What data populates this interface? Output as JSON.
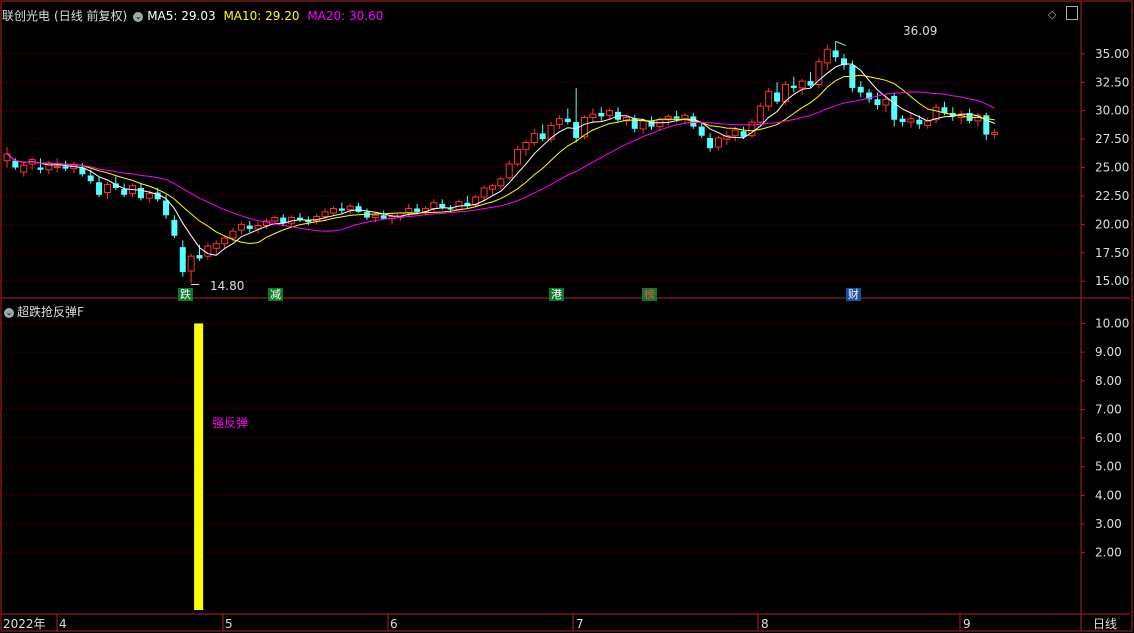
{
  "header": {
    "stock_name": "联创光电",
    "period_mode": "(日线 前复权)",
    "ma5": "MA5: 29.03",
    "ma10": "MA10: 29.20",
    "ma20": "MA20: 30.60"
  },
  "indicator": {
    "name": "超跌抢反弹F",
    "signal_label": "强反弹"
  },
  "event_tags": [
    "跌",
    "减",
    "港",
    "榜",
    "财"
  ],
  "price_annotations": {
    "high": "36.09",
    "low": "14.80"
  },
  "time_axis": {
    "labels": [
      "2022年",
      "4",
      "5",
      "6",
      "7",
      "8",
      "9"
    ],
    "period_button": "日线"
  },
  "colors": {
    "up": "#ff3232",
    "down": "#54ffff",
    "ma5": "#ffffff",
    "ma10": "#ffff00",
    "ma20": "#ff00ff",
    "grid": "#8b0000",
    "axis": "#b22222",
    "signal": "#ffff00",
    "tag_green": "#0b7a2a",
    "tag_blue": "#1d4fa0"
  },
  "chart_data": [
    {
      "type": "candlestick",
      "title": "联创光电 (日线 前复权)",
      "y_ticks": [
        "35.00",
        "32.50",
        "30.00",
        "27.50",
        "25.00",
        "22.50",
        "20.00",
        "17.50",
        "15.00"
      ],
      "ylim": [
        13.7,
        37.8
      ],
      "grid": true,
      "ohlc_estimated": [
        [
          25.6,
          26.8,
          25.0,
          26.2
        ],
        [
          25.6,
          25.8,
          24.8,
          25.0
        ],
        [
          24.6,
          25.4,
          24.2,
          25.2
        ],
        [
          25.3,
          25.9,
          24.8,
          25.7
        ],
        [
          25.0,
          25.8,
          24.5,
          24.8
        ],
        [
          24.8,
          25.6,
          24.4,
          25.4
        ],
        [
          25.0,
          25.8,
          24.6,
          25.1
        ],
        [
          25.1,
          25.6,
          24.7,
          24.9
        ],
        [
          24.9,
          25.5,
          24.5,
          25.2
        ],
        [
          25.0,
          25.4,
          24.2,
          24.4
        ],
        [
          24.3,
          24.8,
          23.6,
          23.8
        ],
        [
          23.7,
          24.2,
          22.4,
          22.6
        ],
        [
          22.8,
          23.7,
          22.2,
          23.5
        ],
        [
          23.6,
          24.2,
          23.0,
          23.2
        ],
        [
          23.1,
          23.6,
          22.4,
          22.6
        ],
        [
          22.7,
          23.6,
          22.4,
          23.4
        ],
        [
          23.2,
          23.6,
          22.1,
          22.3
        ],
        [
          22.3,
          23.0,
          21.9,
          22.7
        ],
        [
          22.8,
          23.2,
          22.0,
          22.2
        ],
        [
          22.1,
          22.6,
          20.5,
          20.8
        ],
        [
          20.4,
          20.8,
          18.8,
          19.0
        ],
        [
          18.0,
          18.6,
          15.4,
          15.8
        ],
        [
          15.9,
          17.4,
          14.8,
          17.2
        ],
        [
          17.3,
          18.2,
          16.8,
          17.0
        ],
        [
          17.2,
          18.4,
          16.9,
          18.1
        ],
        [
          17.9,
          18.6,
          17.4,
          18.3
        ],
        [
          18.3,
          19.0,
          17.9,
          18.8
        ],
        [
          18.8,
          19.7,
          18.5,
          19.4
        ],
        [
          19.5,
          20.2,
          19.1,
          20.0
        ],
        [
          19.9,
          20.3,
          19.3,
          19.6
        ],
        [
          19.6,
          20.2,
          19.2,
          19.9
        ],
        [
          19.9,
          20.5,
          19.6,
          20.3
        ],
        [
          20.3,
          20.8,
          19.9,
          20.6
        ],
        [
          20.6,
          20.9,
          19.9,
          20.1
        ],
        [
          20.1,
          20.8,
          19.8,
          20.6
        ],
        [
          20.6,
          21.0,
          20.2,
          20.4
        ],
        [
          20.4,
          20.7,
          19.9,
          20.2
        ],
        [
          20.3,
          20.9,
          20.0,
          20.7
        ],
        [
          20.7,
          21.4,
          20.4,
          21.1
        ],
        [
          21.0,
          21.6,
          20.7,
          21.4
        ],
        [
          21.4,
          21.9,
          21.0,
          21.2
        ],
        [
          21.3,
          21.8,
          20.9,
          21.6
        ],
        [
          21.6,
          21.9,
          21.0,
          21.1
        ],
        [
          21.1,
          21.4,
          20.4,
          20.6
        ],
        [
          20.6,
          21.0,
          20.2,
          20.8
        ],
        [
          20.8,
          21.2,
          20.4,
          20.5
        ],
        [
          20.5,
          21.0,
          20.0,
          20.7
        ],
        [
          20.6,
          21.1,
          20.3,
          21.0
        ],
        [
          21.0,
          21.8,
          20.7,
          21.4
        ],
        [
          21.4,
          21.8,
          20.9,
          21.1
        ],
        [
          21.1,
          21.6,
          20.8,
          21.4
        ],
        [
          21.4,
          22.2,
          21.1,
          21.9
        ],
        [
          21.8,
          22.2,
          21.3,
          21.5
        ],
        [
          21.4,
          21.7,
          21.0,
          21.3
        ],
        [
          21.3,
          22.2,
          21.1,
          22.0
        ],
        [
          21.9,
          22.5,
          21.4,
          21.6
        ],
        [
          21.7,
          22.6,
          21.5,
          22.4
        ],
        [
          22.4,
          23.4,
          22.1,
          23.2
        ],
        [
          23.1,
          23.6,
          22.6,
          23.4
        ],
        [
          23.4,
          24.2,
          23.1,
          24.0
        ],
        [
          24.1,
          25.6,
          23.9,
          25.3
        ],
        [
          25.3,
          26.9,
          25.1,
          26.6
        ],
        [
          26.6,
          27.4,
          26.0,
          27.2
        ],
        [
          27.2,
          28.4,
          26.9,
          28.0
        ],
        [
          28.0,
          28.8,
          27.3,
          27.5
        ],
        [
          27.5,
          29.0,
          27.2,
          28.7
        ],
        [
          28.8,
          29.6,
          28.4,
          29.3
        ],
        [
          29.3,
          30.2,
          28.8,
          29.0
        ],
        [
          29.0,
          32.0,
          27.2,
          27.6
        ],
        [
          27.7,
          29.6,
          27.5,
          29.4
        ],
        [
          29.4,
          30.2,
          28.9,
          29.7
        ],
        [
          29.8,
          30.3,
          29.1,
          29.5
        ],
        [
          29.6,
          30.2,
          29.2,
          30.0
        ],
        [
          29.9,
          30.3,
          29.0,
          29.2
        ],
        [
          29.1,
          29.6,
          28.7,
          29.4
        ],
        [
          29.3,
          29.6,
          28.1,
          28.4
        ],
        [
          28.4,
          29.3,
          28.0,
          29.1
        ],
        [
          29.1,
          29.5,
          28.3,
          28.6
        ],
        [
          28.6,
          29.4,
          28.3,
          29.2
        ],
        [
          29.2,
          29.7,
          28.7,
          29.5
        ],
        [
          29.5,
          30.0,
          29.0,
          29.3
        ],
        [
          29.3,
          29.8,
          28.8,
          29.6
        ],
        [
          29.5,
          29.8,
          28.4,
          28.6
        ],
        [
          28.6,
          29.0,
          27.6,
          27.8
        ],
        [
          27.6,
          28.0,
          26.4,
          26.7
        ],
        [
          26.8,
          27.8,
          26.5,
          27.6
        ],
        [
          27.5,
          28.2,
          27.0,
          27.8
        ],
        [
          27.8,
          28.6,
          27.3,
          28.3
        ],
        [
          28.2,
          28.6,
          27.5,
          27.7
        ],
        [
          27.8,
          29.3,
          27.6,
          29.0
        ],
        [
          29.0,
          30.7,
          28.8,
          30.4
        ],
        [
          30.4,
          32.0,
          30.0,
          31.7
        ],
        [
          31.6,
          32.5,
          30.6,
          30.8
        ],
        [
          30.8,
          32.6,
          30.5,
          32.3
        ],
        [
          32.2,
          33.0,
          31.6,
          32.0
        ],
        [
          32.0,
          32.8,
          31.4,
          32.6
        ],
        [
          32.6,
          33.4,
          32.0,
          32.2
        ],
        [
          32.3,
          34.6,
          32.0,
          34.3
        ],
        [
          34.2,
          35.8,
          33.6,
          35.4
        ],
        [
          35.3,
          36.09,
          34.3,
          34.7
        ],
        [
          34.6,
          35.0,
          33.6,
          34.0
        ],
        [
          34.0,
          34.4,
          31.6,
          32.0
        ],
        [
          32.1,
          32.6,
          31.2,
          31.6
        ],
        [
          31.6,
          31.9,
          30.7,
          31.0
        ],
        [
          31.0,
          31.6,
          30.1,
          30.5
        ],
        [
          30.5,
          31.2,
          29.9,
          31.0
        ],
        [
          31.3,
          31.6,
          28.6,
          29.2
        ],
        [
          29.3,
          29.6,
          28.6,
          29.0
        ],
        [
          29.0,
          29.8,
          28.5,
          29.3
        ],
        [
          29.2,
          29.6,
          28.4,
          28.8
        ],
        [
          28.7,
          29.4,
          28.4,
          29.1
        ],
        [
          29.2,
          30.6,
          28.9,
          30.3
        ],
        [
          30.3,
          30.8,
          29.6,
          29.8
        ],
        [
          29.8,
          30.3,
          29.1,
          29.5
        ],
        [
          29.4,
          30.0,
          28.8,
          29.7
        ],
        [
          29.8,
          30.2,
          28.9,
          29.1
        ],
        [
          29.1,
          29.8,
          28.6,
          29.6
        ],
        [
          29.6,
          29.8,
          27.4,
          27.9
        ],
        [
          27.9,
          28.4,
          27.6,
          28.1
        ]
      ]
    },
    {
      "type": "bar",
      "title": "超跌抢反弹F",
      "y_ticks": [
        "10.00",
        "9.00",
        "8.00",
        "7.00",
        "6.00",
        "5.00",
        "4.00",
        "3.00",
        "2.00"
      ],
      "ylim": [
        0,
        10.4
      ],
      "signals": [
        {
          "bar_index": 22,
          "value": 10,
          "label": "强反弹"
        }
      ]
    }
  ]
}
